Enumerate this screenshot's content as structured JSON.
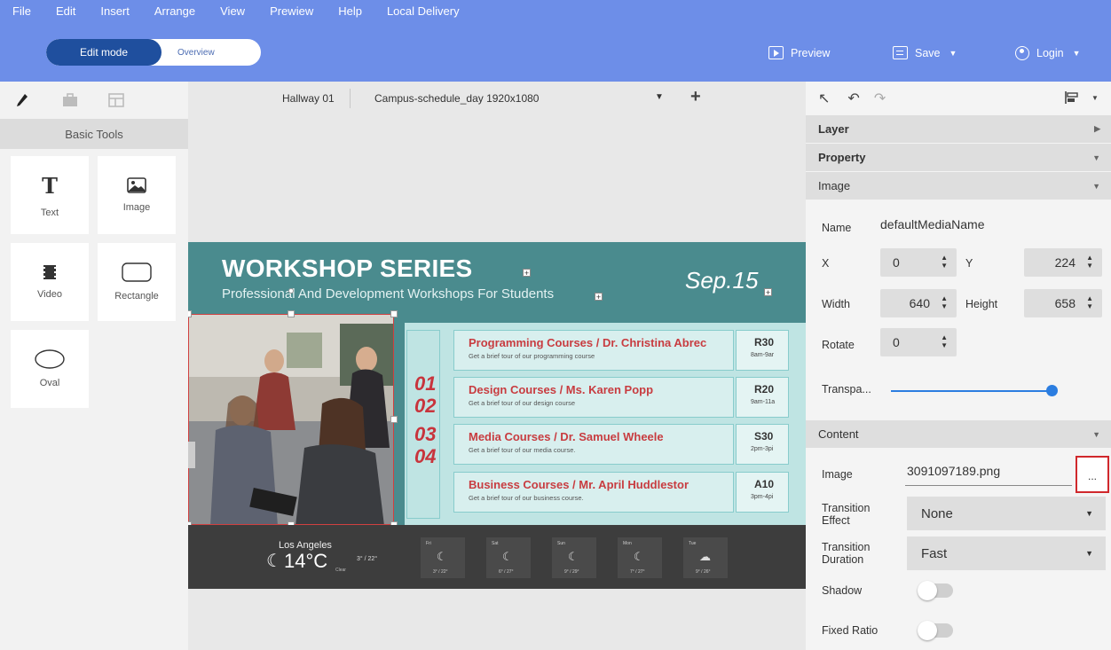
{
  "menu": [
    "File",
    "Edit",
    "Insert",
    "Arrange",
    "View",
    "Prewiew",
    "Help",
    "Local Delivery"
  ],
  "mode": {
    "edit": "Edit mode",
    "overview": "Overview"
  },
  "header_actions": {
    "preview": "Preview",
    "save": "Save",
    "login": "Login"
  },
  "left_panel": {
    "section_title": "Basic Tools",
    "tools": [
      {
        "label": "Text",
        "icon": "text-icon"
      },
      {
        "label": "Image",
        "icon": "image-icon"
      },
      {
        "label": "Video",
        "icon": "video-icon"
      },
      {
        "label": "Rectangle",
        "icon": "rectangle-icon"
      },
      {
        "label": "Oval",
        "icon": "oval-icon"
      }
    ]
  },
  "canvas": {
    "screen": "Hallway 01",
    "layout": "Campus-schedule_day 1920x1080",
    "slide": {
      "title": "WORKSHOP SERIES",
      "subtitle": "Professional And Development Workshops For Students",
      "date": "Sep.15",
      "numbers": [
        "01",
        "02",
        "03",
        "04"
      ],
      "courses": [
        {
          "title": "Programming Courses / Dr. Christina Abrec",
          "desc": "Get a brief tour of our programming course",
          "room": "R30",
          "time": "8am-9ar"
        },
        {
          "title": "Design Courses / Ms. Karen Popp",
          "desc": "Get a brief tour of our design course",
          "room": "R20",
          "time": "9am-11a"
        },
        {
          "title": "Media Courses / Dr. Samuel Wheele",
          "desc": "Get a brief tour of our media course.",
          "room": "S30",
          "time": "2pm-3pi"
        },
        {
          "title": "Business Courses / Mr. April Huddlestor",
          "desc": "Get a brief tour of our business course.",
          "room": "A10",
          "time": "3pm-4pi"
        }
      ],
      "weather": {
        "city": "Los Angeles",
        "temp": "14°C",
        "range": "3° / 22°",
        "condition": "Clear",
        "forecast": [
          {
            "day": "Fri",
            "temp": "3° / 22°"
          },
          {
            "day": "Sat",
            "temp": "6° / 27°"
          },
          {
            "day": "Sun",
            "temp": "9° / 29°"
          },
          {
            "day": "Mon",
            "temp": "7° / 27°"
          },
          {
            "day": "Tue",
            "temp": "9° / 26°"
          }
        ]
      }
    }
  },
  "right_panel": {
    "sections": {
      "layer": "Layer",
      "property": "Property",
      "image": "Image",
      "content": "Content"
    },
    "labels": {
      "name": "Name",
      "x": "X",
      "y": "Y",
      "width": "Width",
      "height": "Height",
      "rotate": "Rotate",
      "transparency": "Transpa...",
      "image": "Image",
      "transition_effect": "Transition Effect",
      "transition_duration": "Transition Duration",
      "shadow": "Shadow",
      "fixed_ratio": "Fixed Ratio"
    },
    "values": {
      "name": "defaultMediaName",
      "x": "0",
      "y": "224",
      "width": "640",
      "height": "658",
      "rotate": "0",
      "image_file": "3091097189.png",
      "transition_effect": "None",
      "transition_duration": "Fast",
      "transparency_level": 1.0,
      "shadow_on": false,
      "fixed_ratio_on": false
    },
    "browse_button": "..."
  },
  "colors": {
    "header": "#6d8ee8",
    "accent": "#1f4f9e",
    "slide_bg": "#4a8b8e",
    "course_title": "#c83c40",
    "highlight": "#d0282c"
  }
}
